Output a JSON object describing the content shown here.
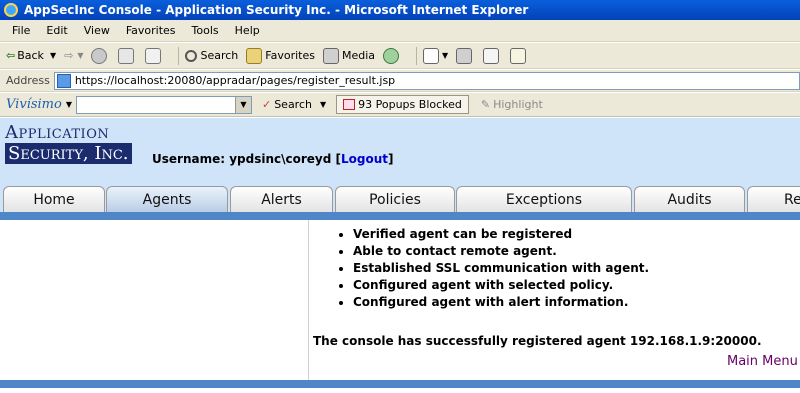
{
  "window": {
    "title": "AppSecInc Console - Application Security Inc. - Microsoft Internet Explorer"
  },
  "menu": [
    "File",
    "Edit",
    "View",
    "Favorites",
    "Tools",
    "Help"
  ],
  "toolbar": {
    "back": "Back",
    "search": "Search",
    "favorites": "Favorites",
    "media": "Media"
  },
  "address": {
    "label": "Address",
    "url": "https://localhost:20080/appradar/pages/register_result.jsp"
  },
  "linksbar": {
    "brand": "Vivísimo",
    "search": "Search",
    "popups": "93 Popups Blocked",
    "highlight": "Highlight"
  },
  "header": {
    "logo_line1": "Application",
    "logo_line2": "Security, Inc.",
    "username_label": "Username: ypdsinc\\coreyd",
    "logout": "Logout"
  },
  "tabs": [
    "Home",
    "Agents",
    "Alerts",
    "Policies",
    "Exceptions",
    "Audits",
    "Re"
  ],
  "active_tab": "Agents",
  "results": [
    "Verified agent can be registered",
    "Able to contact remote agent.",
    "Established SSL communication with agent.",
    "Configured agent with selected policy.",
    "Configured agent with alert information."
  ],
  "message": "The console has successfully registered agent 192.168.1.9:20000.",
  "main_menu_link": "Main Menu",
  "colors": {
    "header_bg": "#cfe3f9",
    "tab_bar": "#4f86c8",
    "link": "#0000cc",
    "main_menu": "#660066"
  }
}
